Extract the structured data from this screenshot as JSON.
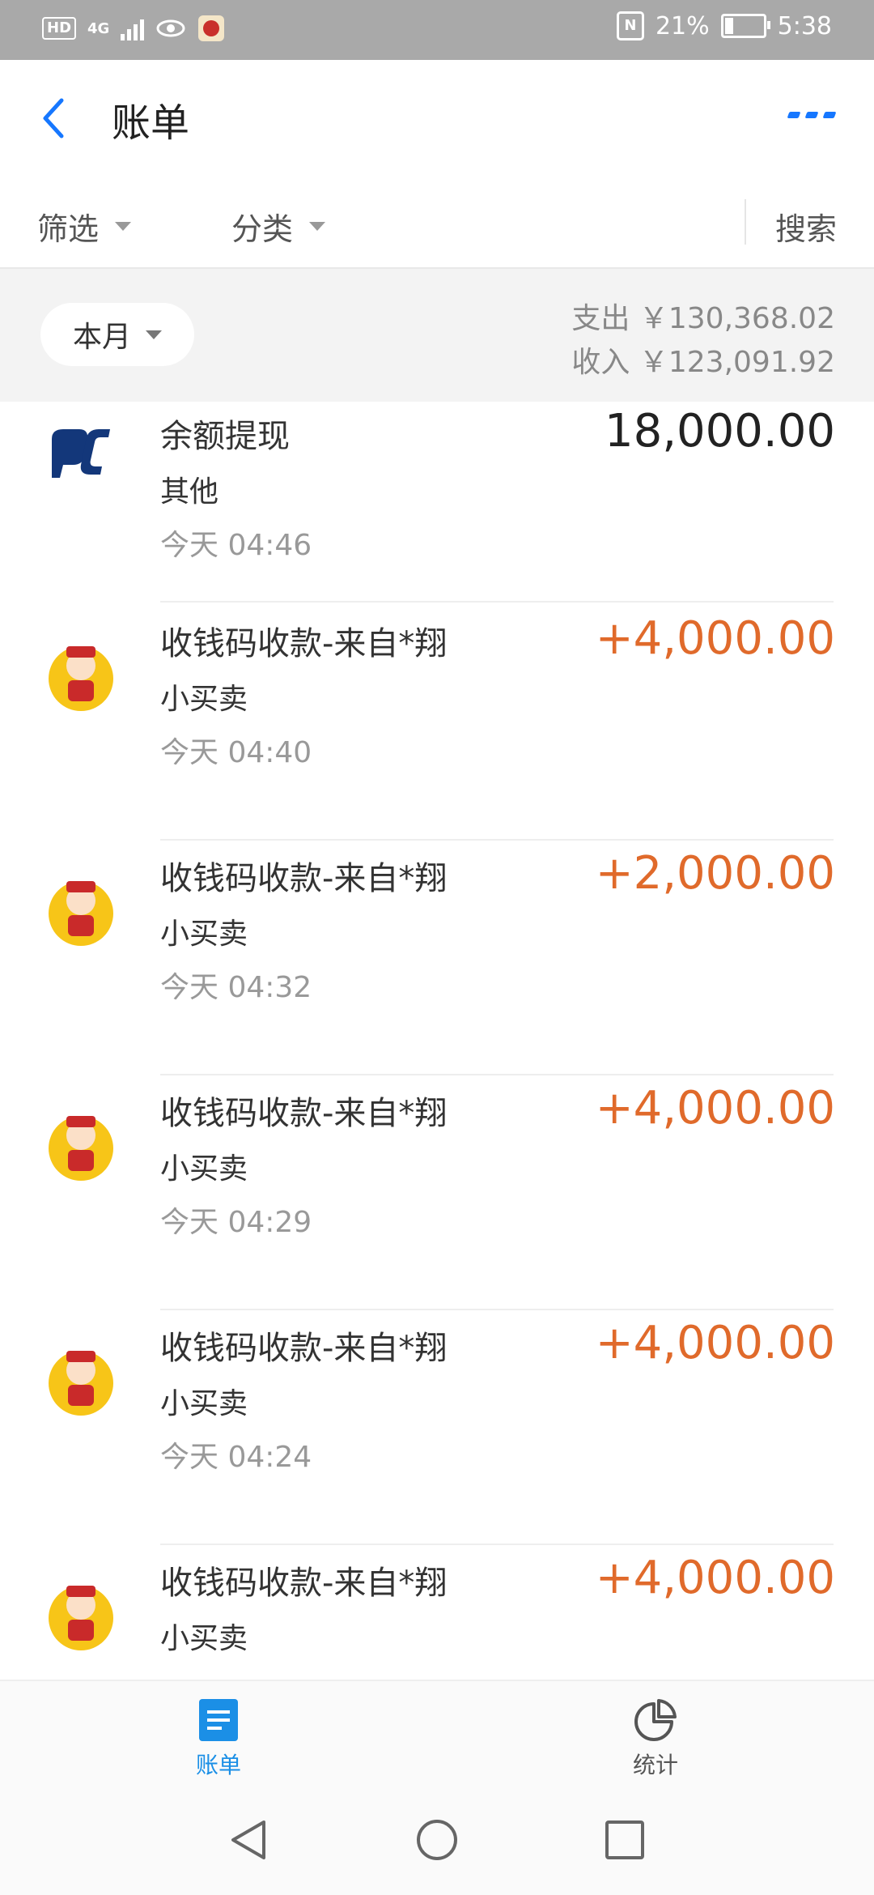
{
  "status": {
    "hd": "HD",
    "network": "4G",
    "nfc": "N",
    "battery": "21%",
    "time": "5:38"
  },
  "header": {
    "title": "账单",
    "more_icon": "more-icon"
  },
  "filters": {
    "filter_label": "筛选",
    "category_label": "分类",
    "search_label": "搜索"
  },
  "summary": {
    "month_label": "本月",
    "expense": "支出 ￥130,368.02",
    "income": "收入 ￥123,091.92"
  },
  "transactions": [
    {
      "name": "余额提现",
      "category": "其他",
      "time": "今天  04:46",
      "amount": "18,000.00",
      "type": "expense",
      "icon": "bank-logo-icon"
    },
    {
      "name": "收钱码收款-来自*翔",
      "category": "小买卖",
      "time": "今天  04:40",
      "amount": "+4,000.00",
      "type": "income",
      "icon": "merchant-avatar-icon"
    },
    {
      "name": "收钱码收款-来自*翔",
      "category": "小买卖",
      "time": "今天  04:32",
      "amount": "+2,000.00",
      "type": "income",
      "icon": "merchant-avatar-icon"
    },
    {
      "name": "收钱码收款-来自*翔",
      "category": "小买卖",
      "time": "今天  04:29",
      "amount": "+4,000.00",
      "type": "income",
      "icon": "merchant-avatar-icon"
    },
    {
      "name": "收钱码收款-来自*翔",
      "category": "小买卖",
      "time": "今天  04:24",
      "amount": "+4,000.00",
      "type": "income",
      "icon": "merchant-avatar-icon"
    },
    {
      "name": "收钱码收款-来自*翔",
      "category": "小买卖",
      "time": "",
      "amount": "+4,000.00",
      "type": "income",
      "icon": "merchant-avatar-icon"
    }
  ],
  "tabs": [
    {
      "label": "账单",
      "icon": "bill-list-icon",
      "active": true
    },
    {
      "label": "统计",
      "icon": "pie-chart-icon",
      "active": false
    }
  ],
  "colors": {
    "accent": "#1677ff",
    "income": "#e06a2b",
    "active_tab": "#1b8fe6"
  }
}
